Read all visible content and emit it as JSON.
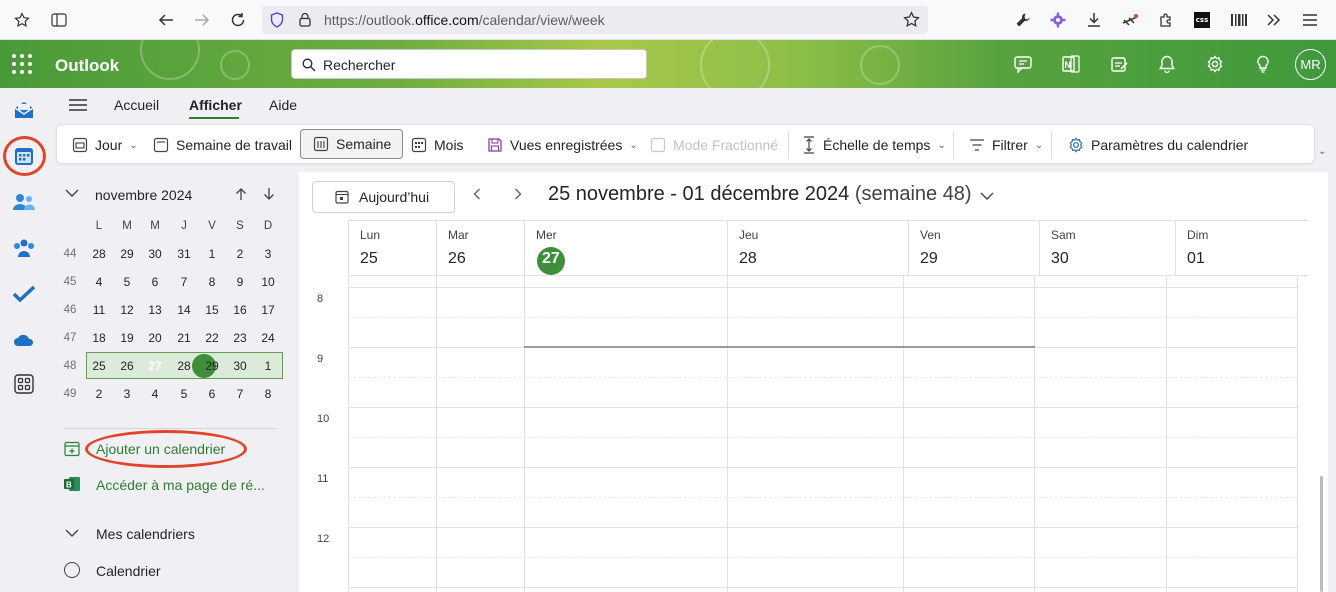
{
  "browser": {
    "url_prefix": "https://outlook.",
    "url_domain": "office.com",
    "url_path": "/calendar/view/week",
    "ext_css_label": "css"
  },
  "header": {
    "app_name": "Outlook",
    "search_placeholder": "Rechercher",
    "avatar_initials": "MR"
  },
  "tabs": [
    {
      "label": "Accueil",
      "selected": false
    },
    {
      "label": "Afficher",
      "selected": true
    },
    {
      "label": "Aide",
      "selected": false
    }
  ],
  "ribbon": {
    "day": "Jour",
    "work_week": "Semaine de travail",
    "week": "Semaine",
    "month": "Mois",
    "saved_views": "Vues enregistrées",
    "split_mode": "Mode Fractionné",
    "time_scale": "Échelle de temps",
    "filter": "Filtrer",
    "calendar_settings": "Paramètres du calendrier"
  },
  "mini_calendar": {
    "title": "novembre 2024",
    "weekdays": [
      "L",
      "M",
      "M",
      "J",
      "V",
      "S",
      "D"
    ],
    "weeks": [
      {
        "num": "44",
        "days": [
          "28",
          "29",
          "30",
          "31",
          "1",
          "2",
          "3"
        ]
      },
      {
        "num": "45",
        "days": [
          "4",
          "5",
          "6",
          "7",
          "8",
          "9",
          "10"
        ]
      },
      {
        "num": "46",
        "days": [
          "11",
          "12",
          "13",
          "14",
          "15",
          "16",
          "17"
        ]
      },
      {
        "num": "47",
        "days": [
          "18",
          "19",
          "20",
          "21",
          "22",
          "23",
          "24"
        ]
      },
      {
        "num": "48",
        "days": [
          "25",
          "26",
          "27",
          "28",
          "29",
          "30",
          "1"
        ]
      },
      {
        "num": "49",
        "days": [
          "2",
          "3",
          "4",
          "5",
          "6",
          "7",
          "8"
        ]
      }
    ]
  },
  "left_pane": {
    "add_calendar": "Ajouter un calendrier",
    "booking_page": "Accéder à ma page de ré...",
    "my_calendars": "Mes calendriers",
    "calendar_item": "Calendrier"
  },
  "main": {
    "today_button": "Aujourd’hui",
    "date_range": "25 novembre - 01 décembre 2024",
    "week_label": "(semaine 48)",
    "days": [
      {
        "name": "Lun",
        "date": "25"
      },
      {
        "name": "Mar",
        "date": "26"
      },
      {
        "name": "Mer",
        "date": "27"
      },
      {
        "name": "Jeu",
        "date": "28"
      },
      {
        "name": "Ven",
        "date": "29"
      },
      {
        "name": "Sam",
        "date": "30"
      },
      {
        "name": "Dim",
        "date": "01"
      }
    ],
    "hours": [
      "8",
      "9",
      "10",
      "11",
      "12"
    ]
  },
  "colors": {
    "accent_green": "#3f8f3a",
    "highlight_red": "#e0452a"
  }
}
